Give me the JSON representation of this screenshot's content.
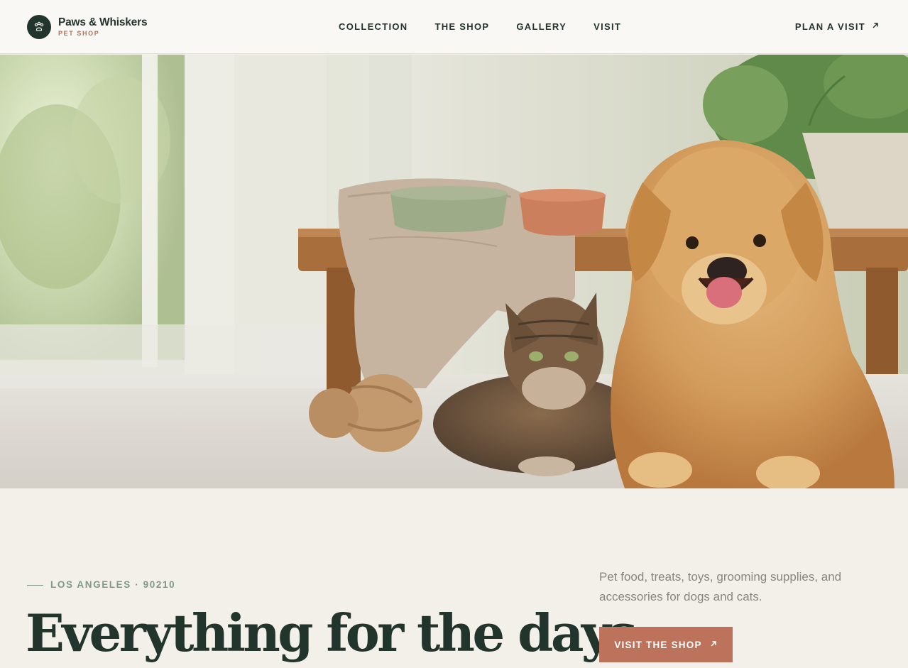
{
  "brand": {
    "name": "Paws & Whiskers",
    "subtitle": "PET SHOP",
    "logo_icon": "paw-icon"
  },
  "nav": {
    "items": [
      {
        "label": "COLLECTION"
      },
      {
        "label": "THE SHOP"
      },
      {
        "label": "GALLERY"
      },
      {
        "label": "VISIT"
      }
    ],
    "cta_label": "PLAN A VISIT",
    "cta_icon": "arrow-up-right-icon"
  },
  "hero": {
    "image_subject": "golden retriever and tabby cat lying on floor beside wooden bench with food bowls and plant"
  },
  "intro": {
    "location": "LOS ANGELES · 90210",
    "headline": "Everything for the days",
    "description": "Pet food, treats, toys, grooming supplies, and accessories for dogs and cats.",
    "button_label": "VISIT THE SHOP",
    "button_icon": "arrow-up-right-icon"
  },
  "colors": {
    "primary": "#22352d",
    "accent": "#bd735b",
    "sage": "#7f9a88",
    "background": "#f3efe9",
    "header_bg": "#faf8f4"
  }
}
